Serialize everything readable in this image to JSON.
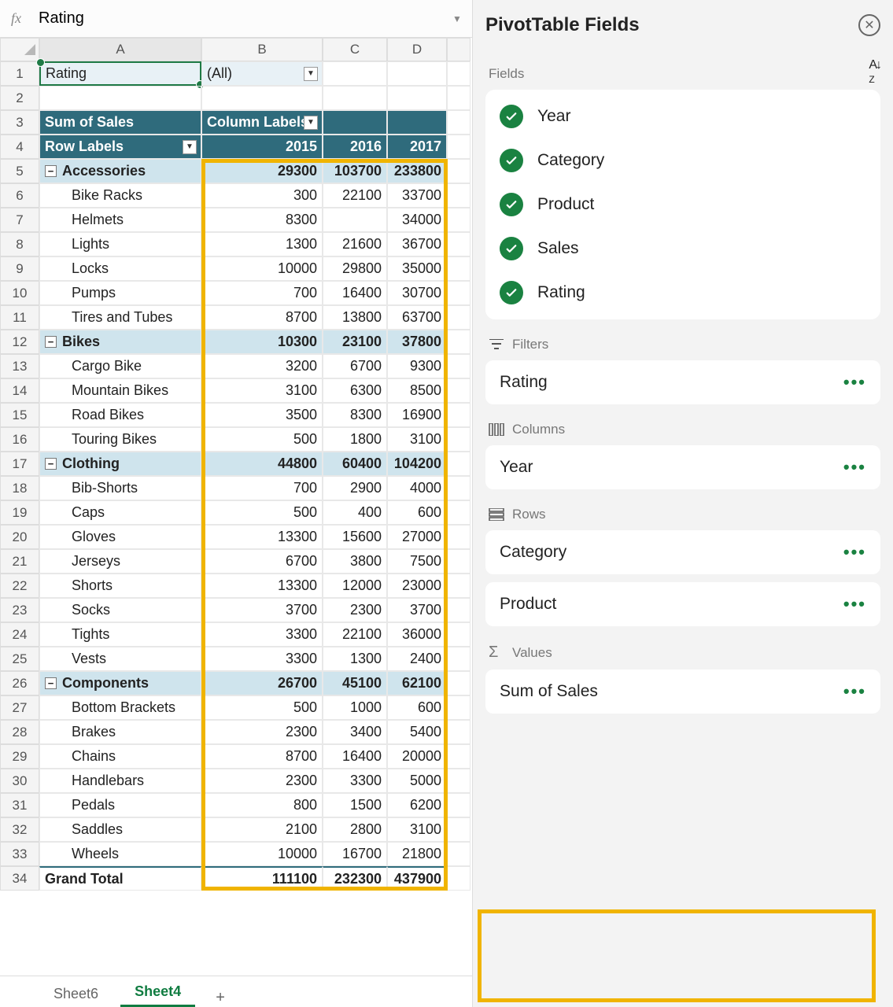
{
  "formula_bar": {
    "fx": "fx",
    "value": "Rating"
  },
  "col_headers": [
    "A",
    "B",
    "C",
    "D"
  ],
  "row_headers": [
    "1",
    "2",
    "3",
    "4",
    "5",
    "6",
    "7",
    "8",
    "9",
    "10",
    "11",
    "12",
    "13",
    "14",
    "15",
    "16",
    "17",
    "18",
    "19",
    "20",
    "21",
    "22",
    "23",
    "24",
    "25",
    "26",
    "27",
    "28",
    "29",
    "30",
    "31",
    "32",
    "33",
    "34"
  ],
  "filter_row": {
    "label": "Rating",
    "value": "(All)"
  },
  "pivot_headers": {
    "top_left": "Sum of Sales",
    "col_label": "Column Labels",
    "row_label": "Row Labels",
    "years": [
      "2015",
      "2016",
      "2017"
    ]
  },
  "rows": [
    {
      "type": "cat",
      "label": "Accessories",
      "vals": [
        "29300",
        "103700",
        "233800"
      ]
    },
    {
      "type": "item",
      "label": "Bike Racks",
      "vals": [
        "300",
        "22100",
        "33700"
      ]
    },
    {
      "type": "item",
      "label": "Helmets",
      "vals": [
        "8300",
        "",
        "34000"
      ]
    },
    {
      "type": "item",
      "label": "Lights",
      "vals": [
        "1300",
        "21600",
        "36700"
      ]
    },
    {
      "type": "item",
      "label": "Locks",
      "vals": [
        "10000",
        "29800",
        "35000"
      ]
    },
    {
      "type": "item",
      "label": "Pumps",
      "vals": [
        "700",
        "16400",
        "30700"
      ]
    },
    {
      "type": "item",
      "label": "Tires and Tubes",
      "vals": [
        "8700",
        "13800",
        "63700"
      ]
    },
    {
      "type": "cat",
      "label": "Bikes",
      "vals": [
        "10300",
        "23100",
        "37800"
      ]
    },
    {
      "type": "item",
      "label": "Cargo Bike",
      "vals": [
        "3200",
        "6700",
        "9300"
      ]
    },
    {
      "type": "item",
      "label": "Mountain Bikes",
      "vals": [
        "3100",
        "6300",
        "8500"
      ]
    },
    {
      "type": "item",
      "label": "Road Bikes",
      "vals": [
        "3500",
        "8300",
        "16900"
      ]
    },
    {
      "type": "item",
      "label": "Touring Bikes",
      "vals": [
        "500",
        "1800",
        "3100"
      ]
    },
    {
      "type": "cat",
      "label": "Clothing",
      "vals": [
        "44800",
        "60400",
        "104200"
      ]
    },
    {
      "type": "item",
      "label": "Bib-Shorts",
      "vals": [
        "700",
        "2900",
        "4000"
      ]
    },
    {
      "type": "item",
      "label": "Caps",
      "vals": [
        "500",
        "400",
        "600"
      ]
    },
    {
      "type": "item",
      "label": "Gloves",
      "vals": [
        "13300",
        "15600",
        "27000"
      ]
    },
    {
      "type": "item",
      "label": "Jerseys",
      "vals": [
        "6700",
        "3800",
        "7500"
      ]
    },
    {
      "type": "item",
      "label": "Shorts",
      "vals": [
        "13300",
        "12000",
        "23000"
      ]
    },
    {
      "type": "item",
      "label": "Socks",
      "vals": [
        "3700",
        "2300",
        "3700"
      ]
    },
    {
      "type": "item",
      "label": "Tights",
      "vals": [
        "3300",
        "22100",
        "36000"
      ]
    },
    {
      "type": "item",
      "label": "Vests",
      "vals": [
        "3300",
        "1300",
        "2400"
      ]
    },
    {
      "type": "cat",
      "label": "Components",
      "vals": [
        "26700",
        "45100",
        "62100"
      ]
    },
    {
      "type": "item",
      "label": "Bottom Brackets",
      "vals": [
        "500",
        "1000",
        "600"
      ]
    },
    {
      "type": "item",
      "label": "Brakes",
      "vals": [
        "2300",
        "3400",
        "5400"
      ]
    },
    {
      "type": "item",
      "label": "Chains",
      "vals": [
        "8700",
        "16400",
        "20000"
      ]
    },
    {
      "type": "item",
      "label": "Handlebars",
      "vals": [
        "2300",
        "3300",
        "5000"
      ]
    },
    {
      "type": "item",
      "label": "Pedals",
      "vals": [
        "800",
        "1500",
        "6200"
      ]
    },
    {
      "type": "item",
      "label": "Saddles",
      "vals": [
        "2100",
        "2800",
        "3100"
      ]
    },
    {
      "type": "item",
      "label": "Wheels",
      "vals": [
        "10000",
        "16700",
        "21800"
      ]
    }
  ],
  "grand_total": {
    "label": "Grand Total",
    "vals": [
      "111100",
      "232300",
      "437900"
    ]
  },
  "tabs": {
    "items": [
      "Sheet6",
      "Sheet4"
    ],
    "active": 1
  },
  "panel": {
    "title": "PivotTable Fields",
    "fields_label": "Fields",
    "fields": [
      "Year",
      "Category",
      "Product",
      "Sales",
      "Rating"
    ],
    "filters_label": "Filters",
    "filters": [
      "Rating"
    ],
    "columns_label": "Columns",
    "columns": [
      "Year"
    ],
    "rows_label": "Rows",
    "rows": [
      "Category",
      "Product"
    ],
    "values_label": "Values",
    "values": [
      "Sum of Sales"
    ]
  }
}
